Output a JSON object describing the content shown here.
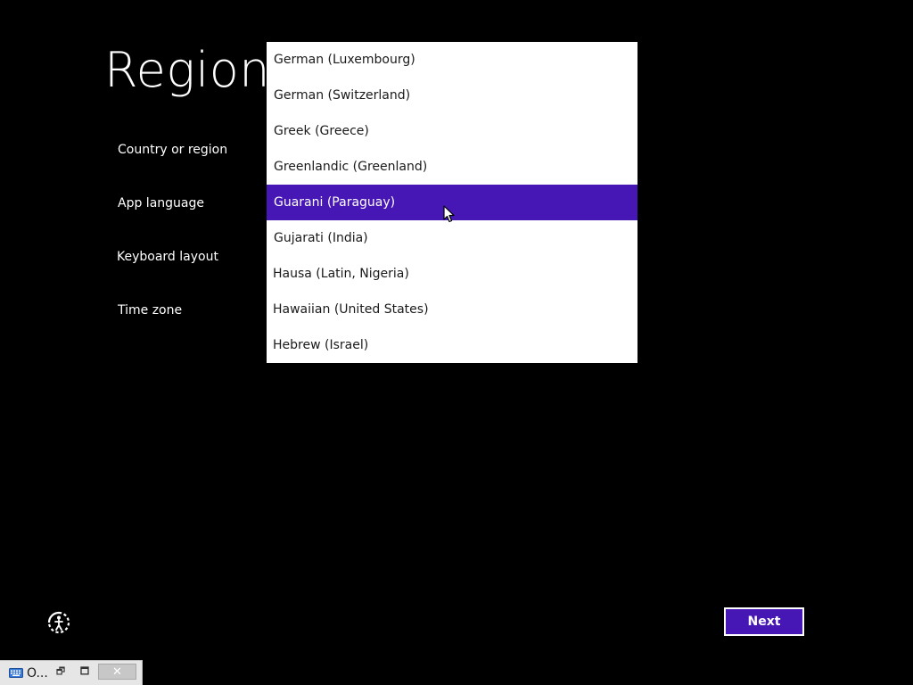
{
  "page": {
    "title": "Region",
    "background_color": "#000000",
    "accent_color": "#4617b4"
  },
  "fields": {
    "country_label": "Country or region",
    "language_label": "App language",
    "keyboard_label": "Keyboard layout",
    "timezone_label": "Time zone"
  },
  "dropdown": {
    "items": [
      {
        "label": "German (Luxembourg)",
        "selected": false
      },
      {
        "label": "German (Switzerland)",
        "selected": false
      },
      {
        "label": "Greek (Greece)",
        "selected": false
      },
      {
        "label": "Greenlandic (Greenland)",
        "selected": false
      },
      {
        "label": "Guarani (Paraguay)",
        "selected": true
      },
      {
        "label": "Gujarati (India)",
        "selected": false
      },
      {
        "label": "Hausa (Latin, Nigeria)",
        "selected": false
      },
      {
        "label": "Hawaiian (United States)",
        "selected": false
      },
      {
        "label": "Hebrew (Israel)",
        "selected": false
      }
    ]
  },
  "buttons": {
    "next_label": "Next"
  },
  "icons": {
    "ease_of_access": "ease-of-access-icon",
    "cursor": "mouse-pointer-icon",
    "keyboard": "keyboard-icon"
  },
  "taskbar": {
    "label": "O...",
    "restore_glyph": "🗗",
    "maximize_glyph": "🗖",
    "close_glyph": "✕"
  }
}
